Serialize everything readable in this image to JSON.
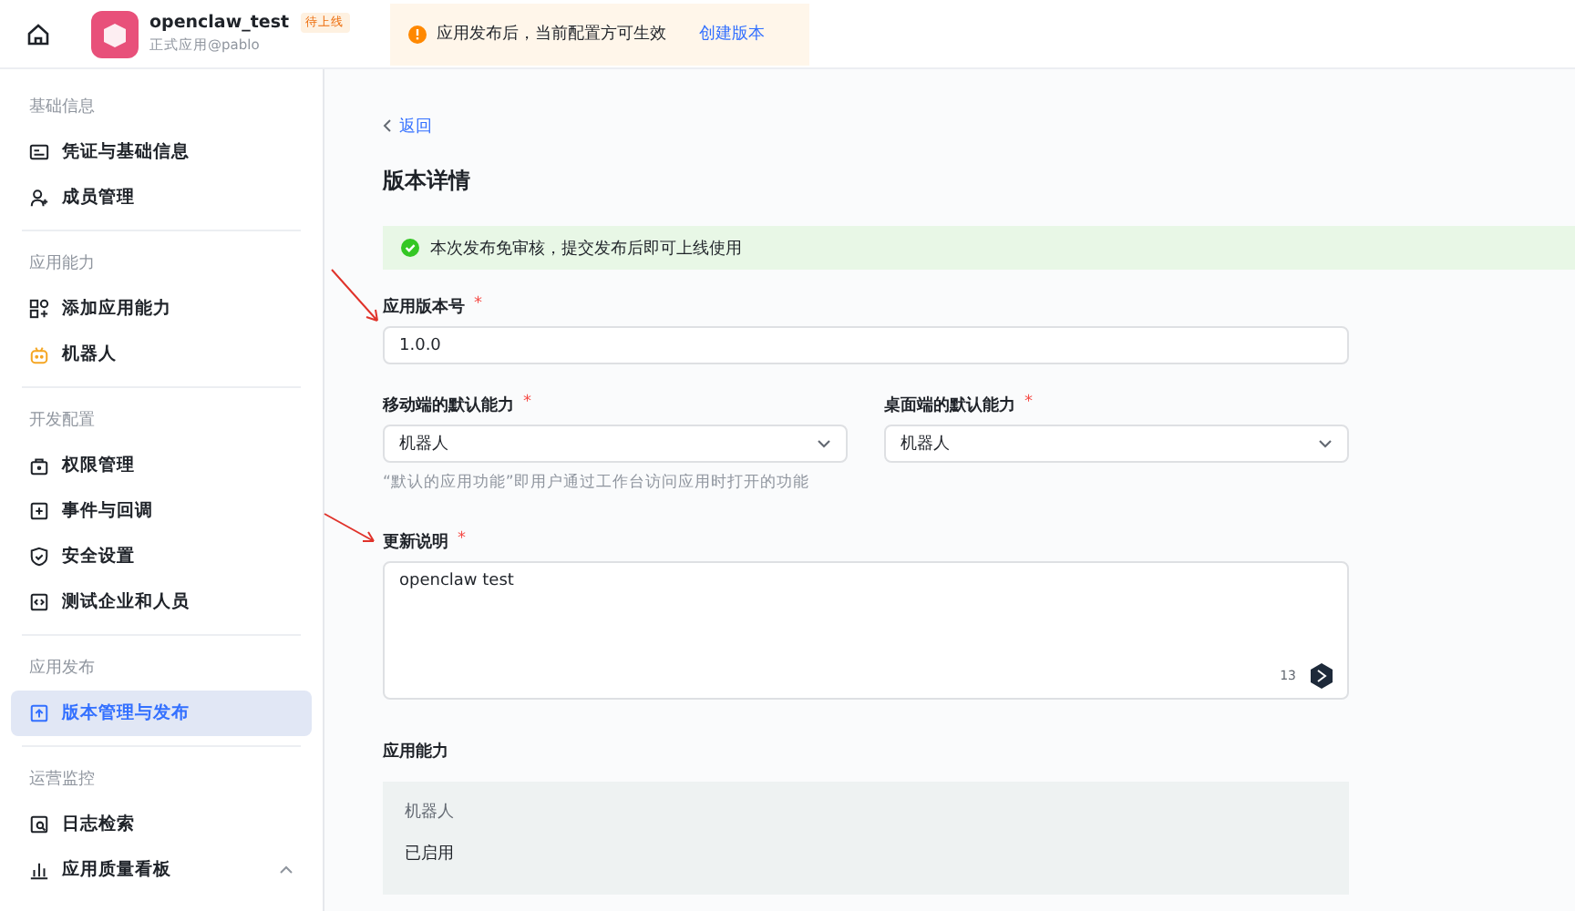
{
  "top_bar": {
    "app_name": "openclaw_test",
    "status_badge": "待上线",
    "app_subtitle": "正式应用@pablo",
    "notice": "应用发布后，当前配置方可生效",
    "notice_link": "创建版本"
  },
  "sidebar": {
    "sections": [
      {
        "title": "基础信息",
        "items": [
          {
            "label": "凭证与基础信息",
            "kind": "card",
            "selected": false
          },
          {
            "label": "成员管理",
            "kind": "user",
            "selected": false
          }
        ]
      },
      {
        "title": "应用能力",
        "items": [
          {
            "label": "添加应用能力",
            "kind": "grid",
            "selected": false
          },
          {
            "label": "机器人",
            "kind": "bot",
            "selected": false
          }
        ]
      },
      {
        "title": "开发配置",
        "items": [
          {
            "label": "权限管理",
            "kind": "lock",
            "selected": false
          },
          {
            "label": "事件与回调",
            "kind": "event",
            "selected": false
          },
          {
            "label": "安全设置",
            "kind": "shield",
            "selected": false
          },
          {
            "label": "测试企业和人员",
            "kind": "code",
            "selected": false
          }
        ]
      },
      {
        "title": "应用发布",
        "items": [
          {
            "label": "版本管理与发布",
            "kind": "upload",
            "selected": true
          }
        ]
      },
      {
        "title": "运营监控",
        "items": [
          {
            "label": "日志检索",
            "kind": "search",
            "selected": false
          },
          {
            "label": "应用质量看板",
            "kind": "chart",
            "selected": false,
            "expanded": true
          }
        ]
      }
    ]
  },
  "main": {
    "back_link": "返回",
    "title": "版本详情",
    "success_banner": "本次发布免审核，提交发布后即可上线使用",
    "version_field": {
      "label": "应用版本号",
      "required_mark": "*",
      "value": "1.0.0"
    },
    "mobile_default": {
      "label": "移动端的默认能力",
      "required_mark": "*",
      "value": "机器人"
    },
    "desktop_default": {
      "label": "桌面端的默认能力",
      "required_mark": "*",
      "value": "机器人"
    },
    "default_hint": "“默认的应用功能”即用户通过工作台访问应用时打开的功能",
    "update_notes": {
      "label": "更新说明",
      "required_mark": "*",
      "value": "openclaw test",
      "char_count": "13"
    },
    "capabilities": {
      "title": "应用能力",
      "name": "机器人",
      "status": "已启用"
    }
  }
}
